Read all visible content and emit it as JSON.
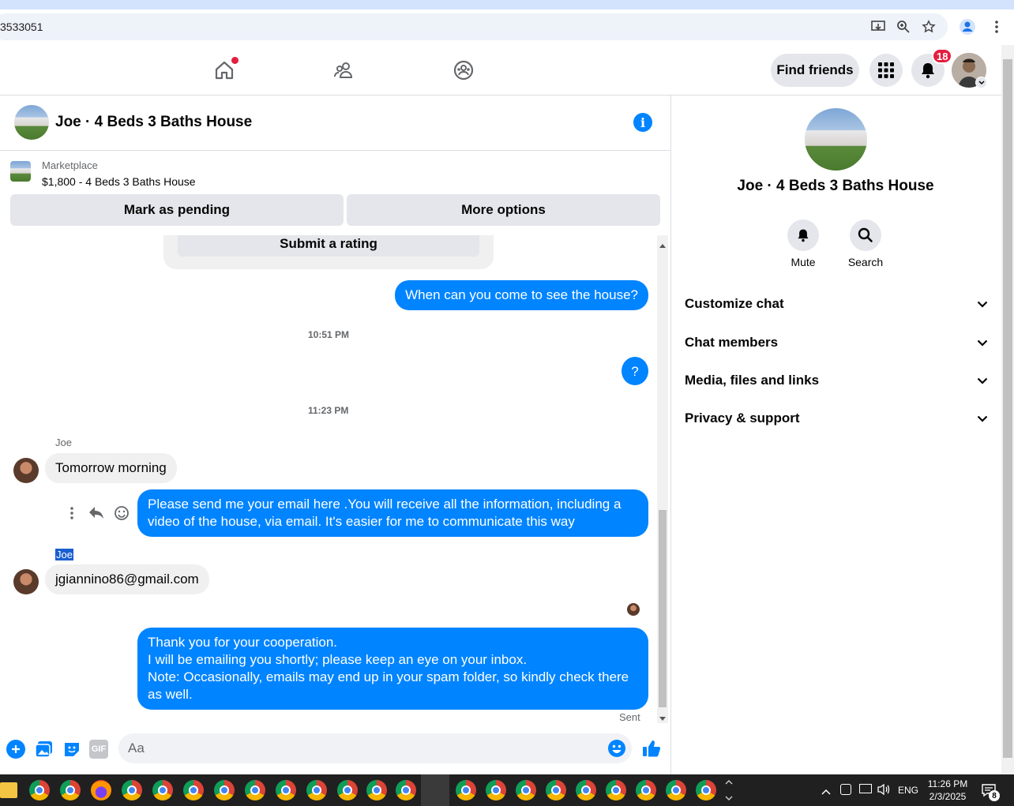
{
  "browser": {
    "url_fragment": "3533051"
  },
  "nav": {
    "find_friends_label": "Find friends",
    "notifications_count": "18"
  },
  "chat": {
    "title": "Joe · 4 Beds 3 Baths House",
    "marketplace_label": "Marketplace",
    "listing": "$1,800 - 4 Beds 3 Baths House",
    "mark_pending_label": "Mark as pending",
    "more_options_label": "More options",
    "submit_rating_label": "Submit a rating",
    "messages": {
      "out_1": "When can you come to see the house?",
      "time_1": "10:51 PM",
      "out_2": "?",
      "time_2": "11:23 PM",
      "sender_1": "Joe",
      "in_1": "Tomorrow morning",
      "out_3": "Please send me your email here .You will receive all the information, including a video of the house, via email. It's easier for me to communicate this way",
      "sender_2": "Joe",
      "in_2": "jgiannino86@gmail.com",
      "out_4_line1": "Thank you for your cooperation.",
      "out_4_line2": "I will be emailing you shortly; please keep an eye on your inbox.",
      "out_4_line3": "Note: Occasionally, emails may end up in your spam folder, so kindly check there as well.",
      "status": "Sent"
    },
    "composer_placeholder": "Aa"
  },
  "right_panel": {
    "name": "Joe · 4 Beds 3 Baths House",
    "mute_label": "Mute",
    "search_label": "Search",
    "sections": [
      "Customize chat",
      "Chat members",
      "Media, files and links",
      "Privacy & support"
    ]
  },
  "taskbar": {
    "language": "ENG",
    "time": "11:26 PM",
    "date": "2/3/2025",
    "notification_count": "8"
  },
  "colors": {
    "accent": "#0084ff",
    "badge": "#e41e3f",
    "button_bg": "#e4e6eb"
  }
}
